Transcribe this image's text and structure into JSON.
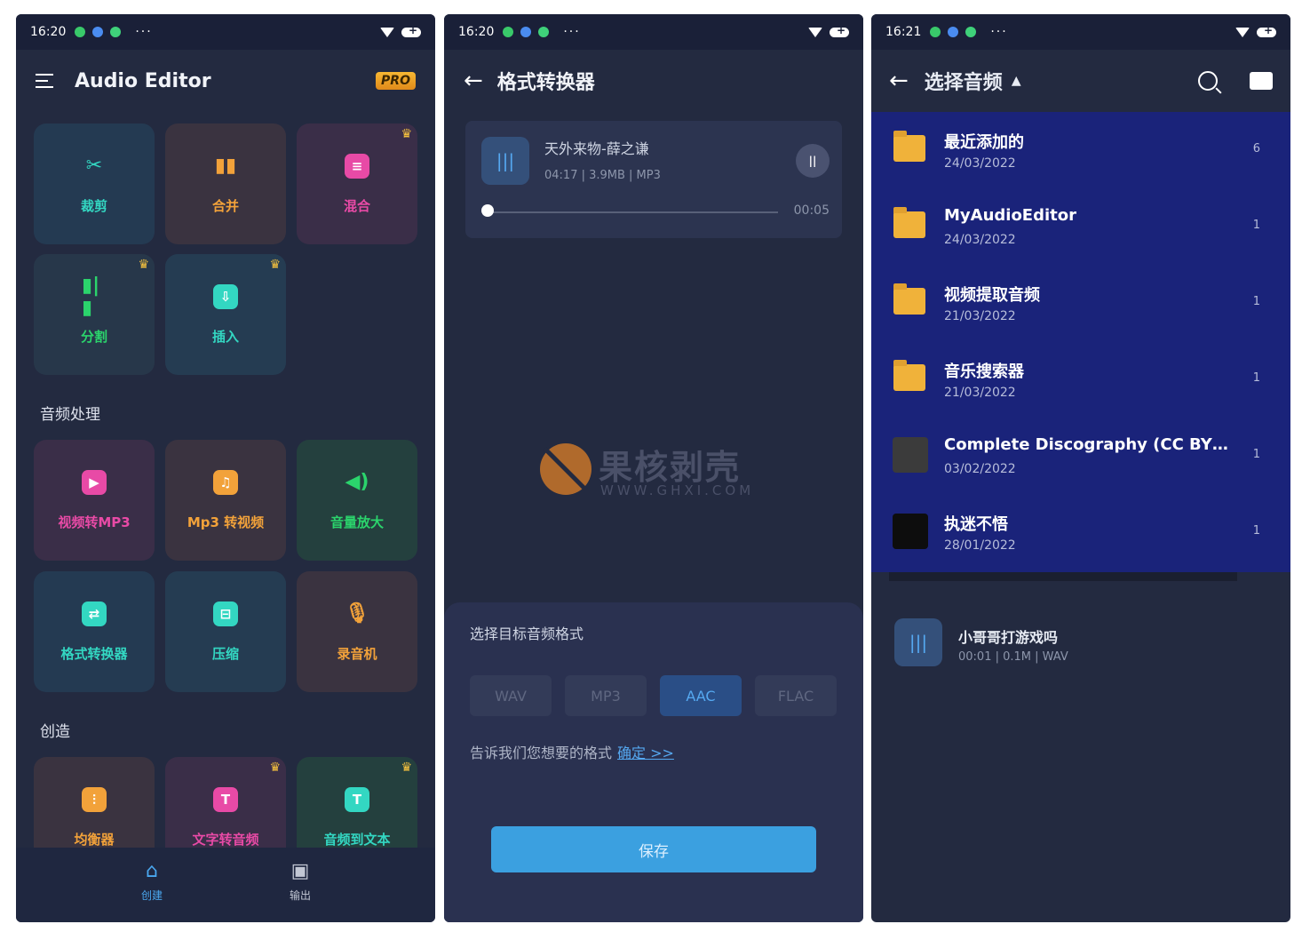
{
  "colors": {
    "accent": "#3ba0e0",
    "pro_badge": "#f7b733",
    "background": "#232a40",
    "dropdown": "#1a237a"
  },
  "screen1": {
    "status": {
      "time": "16:20",
      "more": "···"
    },
    "app_title": "Audio Editor",
    "pro_label": "PRO",
    "tools": [
      {
        "label": "裁剪",
        "icon": "scissors-icon",
        "color": "#33d7c2",
        "premium": false
      },
      {
        "label": "合并",
        "icon": "merge-icon",
        "color": "#f2a23a",
        "premium": false
      },
      {
        "label": "混合",
        "icon": "mix-icon",
        "color": "#e84aa6",
        "premium": true
      },
      {
        "label": "分割",
        "icon": "split-icon",
        "color": "#2bd46c",
        "premium": true
      },
      {
        "label": "插入",
        "icon": "insert-icon",
        "color": "#33d7c2",
        "premium": true
      }
    ],
    "section_audio": "音频处理",
    "audio_tools": [
      {
        "label": "视频转MP3",
        "icon": "video-to-mp3-icon",
        "color": "#e84aa6",
        "premium": false
      },
      {
        "label": "Mp3 转视频",
        "icon": "mp3-to-video-icon",
        "color": "#f2a23a",
        "premium": false
      },
      {
        "label": "音量放大",
        "icon": "volume-icon",
        "color": "#2bd46c",
        "premium": false
      },
      {
        "label": "格式转换器",
        "icon": "convert-icon",
        "color": "#33d7c2",
        "premium": false
      },
      {
        "label": "压缩",
        "icon": "compress-icon",
        "color": "#33d7c2",
        "premium": false
      },
      {
        "label": "录音机",
        "icon": "microphone-icon",
        "color": "#f2a23a",
        "premium": false
      }
    ],
    "section_create": "创造",
    "create_tools": [
      {
        "label": "均衡器",
        "icon": "equalizer-icon",
        "color": "#f2a23a",
        "premium": false
      },
      {
        "label": "文字转音频",
        "icon": "text-to-speech-icon",
        "color": "#e84aa6",
        "premium": true
      },
      {
        "label": "音频到文本",
        "icon": "speech-to-text-icon",
        "color": "#33d7c2",
        "premium": true
      }
    ],
    "nav": [
      {
        "label": "创建",
        "icon": "home-icon",
        "active": true
      },
      {
        "label": "输出",
        "icon": "output-folder-icon",
        "active": false
      }
    ]
  },
  "screen2": {
    "status": {
      "time": "16:20",
      "more": "···"
    },
    "title": "格式转换器",
    "player": {
      "track": "天外来物-薛之谦",
      "meta": "04:17 | 3.9MB | MP3",
      "position": "00:05",
      "progress": 0.0
    },
    "watermark": {
      "big": "果核剥壳",
      "small": "WWW.GHXI.COM"
    },
    "prompt": "选择目标音频格式",
    "formats": [
      "WAV",
      "MP3",
      "AAC",
      "FLAC"
    ],
    "selected_format": "AAC",
    "hint": "告诉我们您想要的格式",
    "hint_link": "确定 >>",
    "save": "保存"
  },
  "screen3": {
    "status": {
      "time": "16:21",
      "more": "···"
    },
    "title": "选择音频",
    "folders": [
      {
        "name": "最近添加的",
        "date": "24/03/2022",
        "count": "6",
        "kind": "folder"
      },
      {
        "name": "MyAudioEditor",
        "date": "24/03/2022",
        "count": "1",
        "kind": "folder"
      },
      {
        "name": "视频提取音频",
        "date": "21/03/2022",
        "count": "1",
        "kind": "folder"
      },
      {
        "name": "音乐搜索器",
        "date": "21/03/2022",
        "count": "1",
        "kind": "folder"
      },
      {
        "name": "Complete Discography (CC BY Attr...",
        "date": "03/02/2022",
        "count": "1",
        "kind": "album"
      },
      {
        "name": "执迷不悟",
        "date": "28/01/2022",
        "count": "1",
        "kind": "album-dark"
      }
    ],
    "background_item": {
      "title": "小哥哥打游戏吗",
      "meta": "00:01 | 0.1M | WAV"
    }
  }
}
